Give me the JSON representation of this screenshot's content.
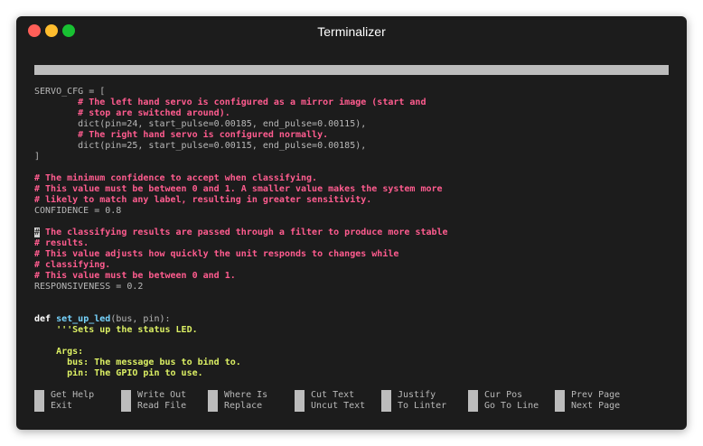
{
  "window": {
    "title": "Terminalizer"
  },
  "editor": {
    "lines": [
      [
        {
          "t": "SERVO_CFG = [",
          "c": "normal"
        }
      ],
      [
        {
          "t": "        # The left hand servo is configured as a mirror image (start and",
          "c": "comment"
        }
      ],
      [
        {
          "t": "        # stop are switched around).",
          "c": "comment"
        }
      ],
      [
        {
          "t": "        dict(pin=24, start_pulse=0.00185, end_pulse=0.00115),",
          "c": "normal"
        }
      ],
      [
        {
          "t": "        # The right hand servo is configured normally.",
          "c": "comment"
        }
      ],
      [
        {
          "t": "        dict(pin=25, start_pulse=0.00115, end_pulse=0.00185),",
          "c": "normal"
        }
      ],
      [
        {
          "t": "]",
          "c": "normal"
        }
      ],
      [],
      [
        {
          "t": "# The minimum confidence to accept when classifying.",
          "c": "comment"
        }
      ],
      [
        {
          "t": "# This value must be between 0 and 1. A smaller value makes the system more",
          "c": "comment"
        }
      ],
      [
        {
          "t": "# likely to match any label, resulting in greater sensitivity.",
          "c": "comment"
        }
      ],
      [
        {
          "t": "CONFIDENCE = 0.8",
          "c": "normal"
        }
      ],
      [],
      [
        {
          "t": "#",
          "c": "cursor"
        },
        {
          "t": " The classifying results are passed through a filter to produce more stable",
          "c": "comment"
        }
      ],
      [
        {
          "t": "# results.",
          "c": "comment"
        }
      ],
      [
        {
          "t": "# This value adjusts how quickly the unit responds to changes while",
          "c": "comment"
        }
      ],
      [
        {
          "t": "# classifying.",
          "c": "comment"
        }
      ],
      [
        {
          "t": "# This value must be between 0 and 1.",
          "c": "comment"
        }
      ],
      [
        {
          "t": "RESPONSIVENESS = 0.2",
          "c": "normal"
        }
      ],
      [],
      [],
      [
        {
          "t": "def ",
          "c": "keyword"
        },
        {
          "t": "set_up_led",
          "c": "func"
        },
        {
          "t": "(bus, pin):",
          "c": "normal"
        }
      ],
      [
        {
          "t": "    '''Sets up the status LED.",
          "c": "doc"
        }
      ],
      [],
      [
        {
          "t": "    Args:",
          "c": "doc"
        }
      ],
      [
        {
          "t": "      bus: The message bus to bind to.",
          "c": "doc"
        }
      ],
      [
        {
          "t": "      pin: The GPIO pin to use.",
          "c": "doc"
        }
      ]
    ]
  },
  "shortcuts": [
    {
      "top": "Get Help",
      "bottom": "Exit"
    },
    {
      "top": "Write Out",
      "bottom": "Read File"
    },
    {
      "top": "Where Is",
      "bottom": "Replace"
    },
    {
      "top": "Cut Text",
      "bottom": "Uncut Text"
    },
    {
      "top": "Justify",
      "bottom": "To Linter"
    },
    {
      "top": "Cur Pos",
      "bottom": "Go To Line"
    },
    {
      "top": "Prev Page",
      "bottom": "Next Page"
    }
  ]
}
